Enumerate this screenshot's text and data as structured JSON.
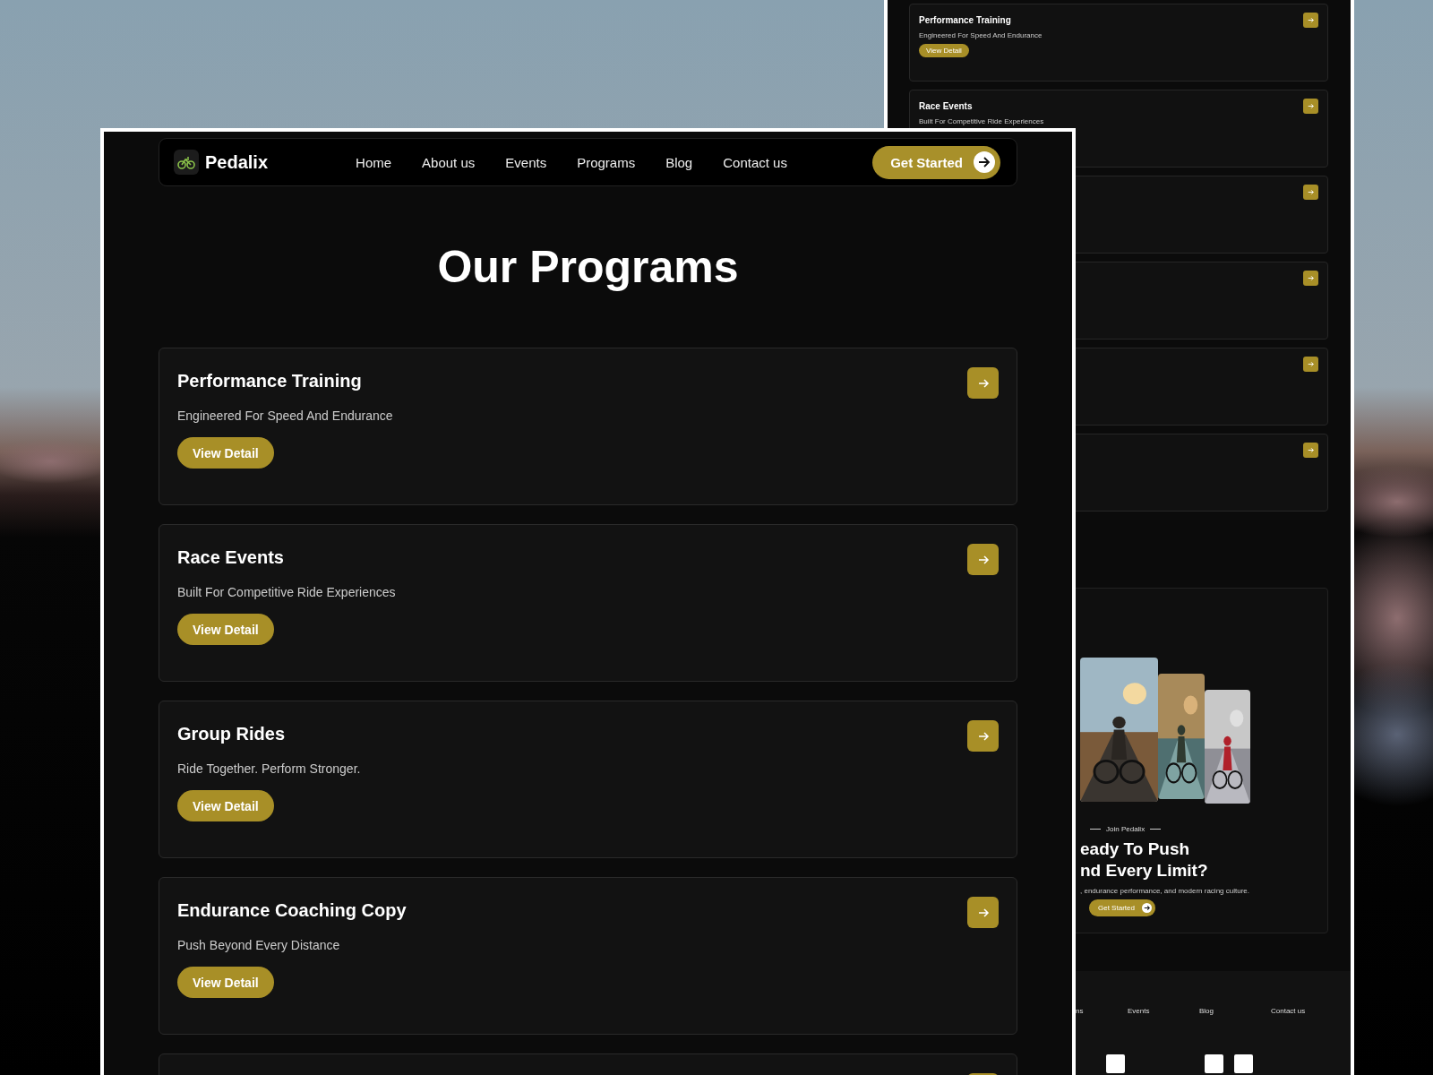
{
  "back_page": {
    "programs": [
      {
        "title": "Performance Training",
        "subtitle": "Engineered For Speed And Endurance",
        "button": "View Detail",
        "arrow": true
      },
      {
        "title": "Race Events",
        "subtitle": "Built For Competitive Ride Experiences",
        "arrow": true
      },
      {
        "arrow": true
      },
      {
        "arrow": true
      },
      {
        "arrow": true
      },
      {
        "arrow": true
      }
    ],
    "cta": {
      "pictures": [
        {
          "kind": "picture"
        },
        {
          "kind": "picture"
        },
        {
          "kind": "picture"
        }
      ],
      "eyebrow": "Join Pedalix",
      "heading_lines": [
        "eady To Push",
        "nd Every Limit?"
      ],
      "text": ", endurance performance, and modern racing culture.",
      "button": "Get Started"
    },
    "footer_links": [
      "ns",
      "Events",
      "Blog",
      "Contact us"
    ],
    "social_icons": [
      {
        "kind": "square"
      },
      {
        "kind": "square"
      },
      {
        "kind": "square"
      }
    ]
  },
  "front_page": {
    "brand": "Pedalix",
    "nav": [
      "Home",
      "About us",
      "Events",
      "Programs",
      "Blog",
      "Contact us"
    ],
    "cta_button": "Get Started",
    "title": "Our Programs",
    "programs": [
      {
        "title": "Performance Training",
        "subtitle": "Engineered For Speed And Endurance",
        "button": "View Detail",
        "arrow": true
      },
      {
        "title": "Race Events",
        "subtitle": "Built For Competitive Ride Experiences",
        "button": "View Detail",
        "arrow": true
      },
      {
        "title": "Group Rides",
        "subtitle": "Ride Together. Perform Stronger.",
        "button": "View Detail",
        "arrow": true
      },
      {
        "title": "Endurance Coaching Copy",
        "subtitle": "Push Beyond Every Distance",
        "button": "View Detail",
        "arrow": true
      },
      {
        "arrow": true
      }
    ]
  }
}
